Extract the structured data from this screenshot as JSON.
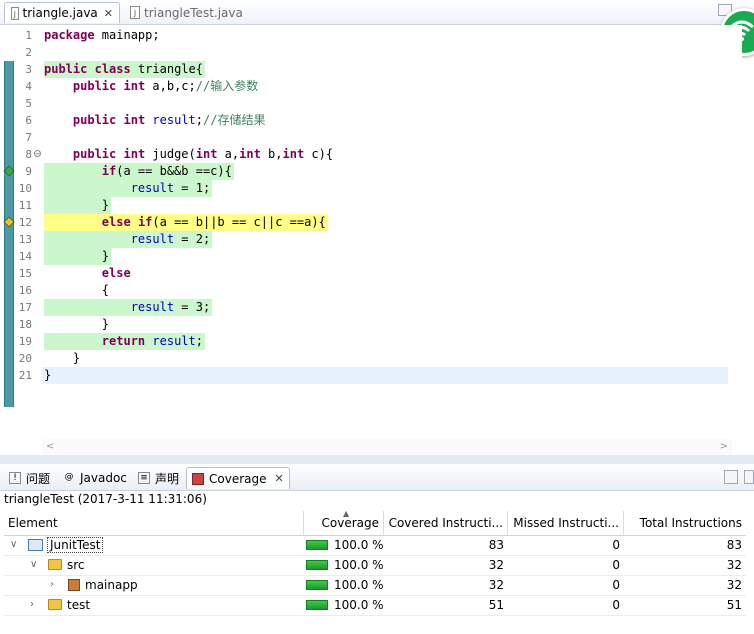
{
  "editor_tabs": [
    {
      "label": "triangle.java",
      "active": true
    },
    {
      "label": "triangleTest.java",
      "active": false
    }
  ],
  "code_lines": [
    {
      "n": "1",
      "text": "package mainapp;",
      "hl": ""
    },
    {
      "n": "2",
      "text": "",
      "hl": ""
    },
    {
      "n": "3",
      "text": "public class triangle{",
      "hl": "green"
    },
    {
      "n": "4",
      "text": "    public int a,b,c;//输入参数",
      "hl": ""
    },
    {
      "n": "5",
      "text": "",
      "hl": ""
    },
    {
      "n": "6",
      "text": "    public int result;//存储结果",
      "hl": ""
    },
    {
      "n": "7",
      "text": "",
      "hl": ""
    },
    {
      "n": "8",
      "text": "    public int judge(int a,int b,int c){",
      "hl": ""
    },
    {
      "n": "9",
      "text": "        if(a == b&&b ==c){",
      "hl": "green"
    },
    {
      "n": "10",
      "text": "            result = 1;",
      "hl": "green"
    },
    {
      "n": "11",
      "text": "        }",
      "hl": "green"
    },
    {
      "n": "12",
      "text": "        else if(a == b||b == c||c ==a){",
      "hl": "yellow"
    },
    {
      "n": "13",
      "text": "            result = 2;",
      "hl": "green"
    },
    {
      "n": "14",
      "text": "        }",
      "hl": "green"
    },
    {
      "n": "15",
      "text": "        else",
      "hl": ""
    },
    {
      "n": "16",
      "text": "        {",
      "hl": ""
    },
    {
      "n": "17",
      "text": "            result = 3;",
      "hl": "green"
    },
    {
      "n": "18",
      "text": "        }",
      "hl": ""
    },
    {
      "n": "19",
      "text": "        return result;",
      "hl": "green"
    },
    {
      "n": "20",
      "text": "    }",
      "hl": ""
    },
    {
      "n": "21",
      "text": "}",
      "hl": ""
    }
  ],
  "view_tabs": [
    {
      "label": "问题",
      "icon": "problems-icon"
    },
    {
      "label": "Javadoc",
      "icon": "javadoc-icon"
    },
    {
      "label": "声明",
      "icon": "declaration-icon"
    },
    {
      "label": "Coverage",
      "icon": "coverage-icon",
      "active": true
    }
  ],
  "session_label": "triangleTest (2017-3-11 11:31:06)",
  "table": {
    "headers": [
      "Element",
      "Coverage",
      "Covered Instructi...",
      "Missed Instructi...",
      "Total Instructions"
    ],
    "rows": [
      {
        "element": "JunitTest",
        "coverage": "100.0 %",
        "covered": "83",
        "missed": "0",
        "total": "83"
      },
      {
        "element": "src",
        "coverage": "100.0 %",
        "covered": "32",
        "missed": "0",
        "total": "32"
      },
      {
        "element": "mainapp",
        "coverage": "100.0 %",
        "covered": "32",
        "missed": "0",
        "total": "32"
      },
      {
        "element": "test",
        "coverage": "100.0 %",
        "covered": "51",
        "missed": "0",
        "total": "51"
      }
    ]
  },
  "colors": {
    "covered": "#ccf7cc",
    "partial": "#ffff88",
    "keyword": "#7f0055",
    "field": "#0000c0",
    "comment": "#3f7f5f"
  }
}
